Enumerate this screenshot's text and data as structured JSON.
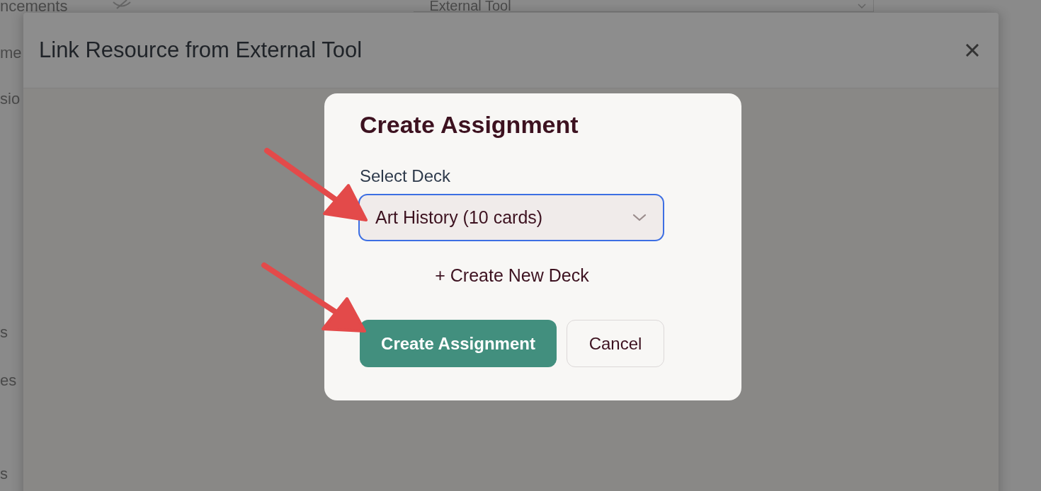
{
  "background_page": {
    "header_fragment": "ncements",
    "tool_select": {
      "value": "External Tool"
    },
    "nav_fragments": [
      "me",
      "sio",
      "s",
      "es",
      "s"
    ]
  },
  "modal": {
    "title": "Link Resource from External Tool"
  },
  "dialog": {
    "title": "Create Assignment",
    "deck_select": {
      "label": "Select Deck",
      "value": "Art History (10 cards)",
      "focused": true
    },
    "create_deck_link": "+ Create New Deck",
    "buttons": [
      {
        "label": "Create Assignment",
        "kind": "primary"
      },
      {
        "label": "Cancel",
        "kind": "secondary"
      }
    ]
  }
}
